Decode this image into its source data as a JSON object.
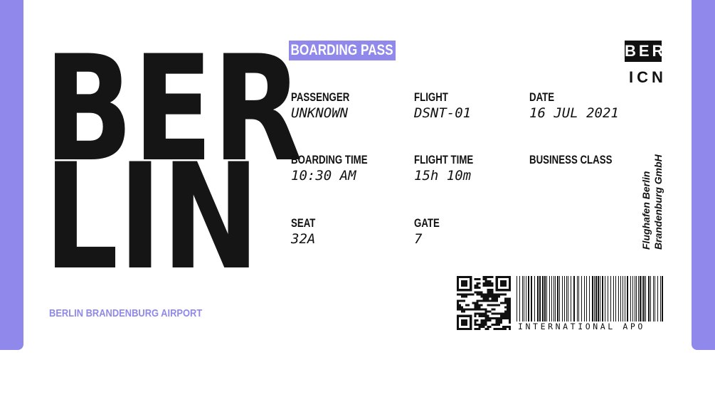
{
  "ticket": {
    "city_line1": "BER",
    "city_line2": "LIN",
    "airport_name": "BERLIN BRANDENBURG AIRPORT",
    "title": "BOARDING PASS",
    "origin_code": "BER",
    "destination_code": "ICN",
    "operator": [
      "Flughafen Berlin",
      "Brandenburg GmbH"
    ],
    "barcode_text": "INTERNATIONAL APO",
    "accent_color": "#9088ea",
    "fields": {
      "passenger": {
        "label": "PASSENGER",
        "value": "UNKNOWN"
      },
      "flight": {
        "label": "FLIGHT",
        "value": "DSNT-01"
      },
      "date": {
        "label": "DATE",
        "value": "16 JUL 2021"
      },
      "boarding_time": {
        "label": "BOARDING TIME",
        "value": "10:30 AM"
      },
      "flight_time": {
        "label": "FLIGHT TIME",
        "value": "15h 10m"
      },
      "class": {
        "label": "BUSINESS CLASS"
      },
      "seat": {
        "label": "SEAT",
        "value": "32A"
      },
      "gate": {
        "label": "GATE",
        "value": "7"
      }
    }
  }
}
